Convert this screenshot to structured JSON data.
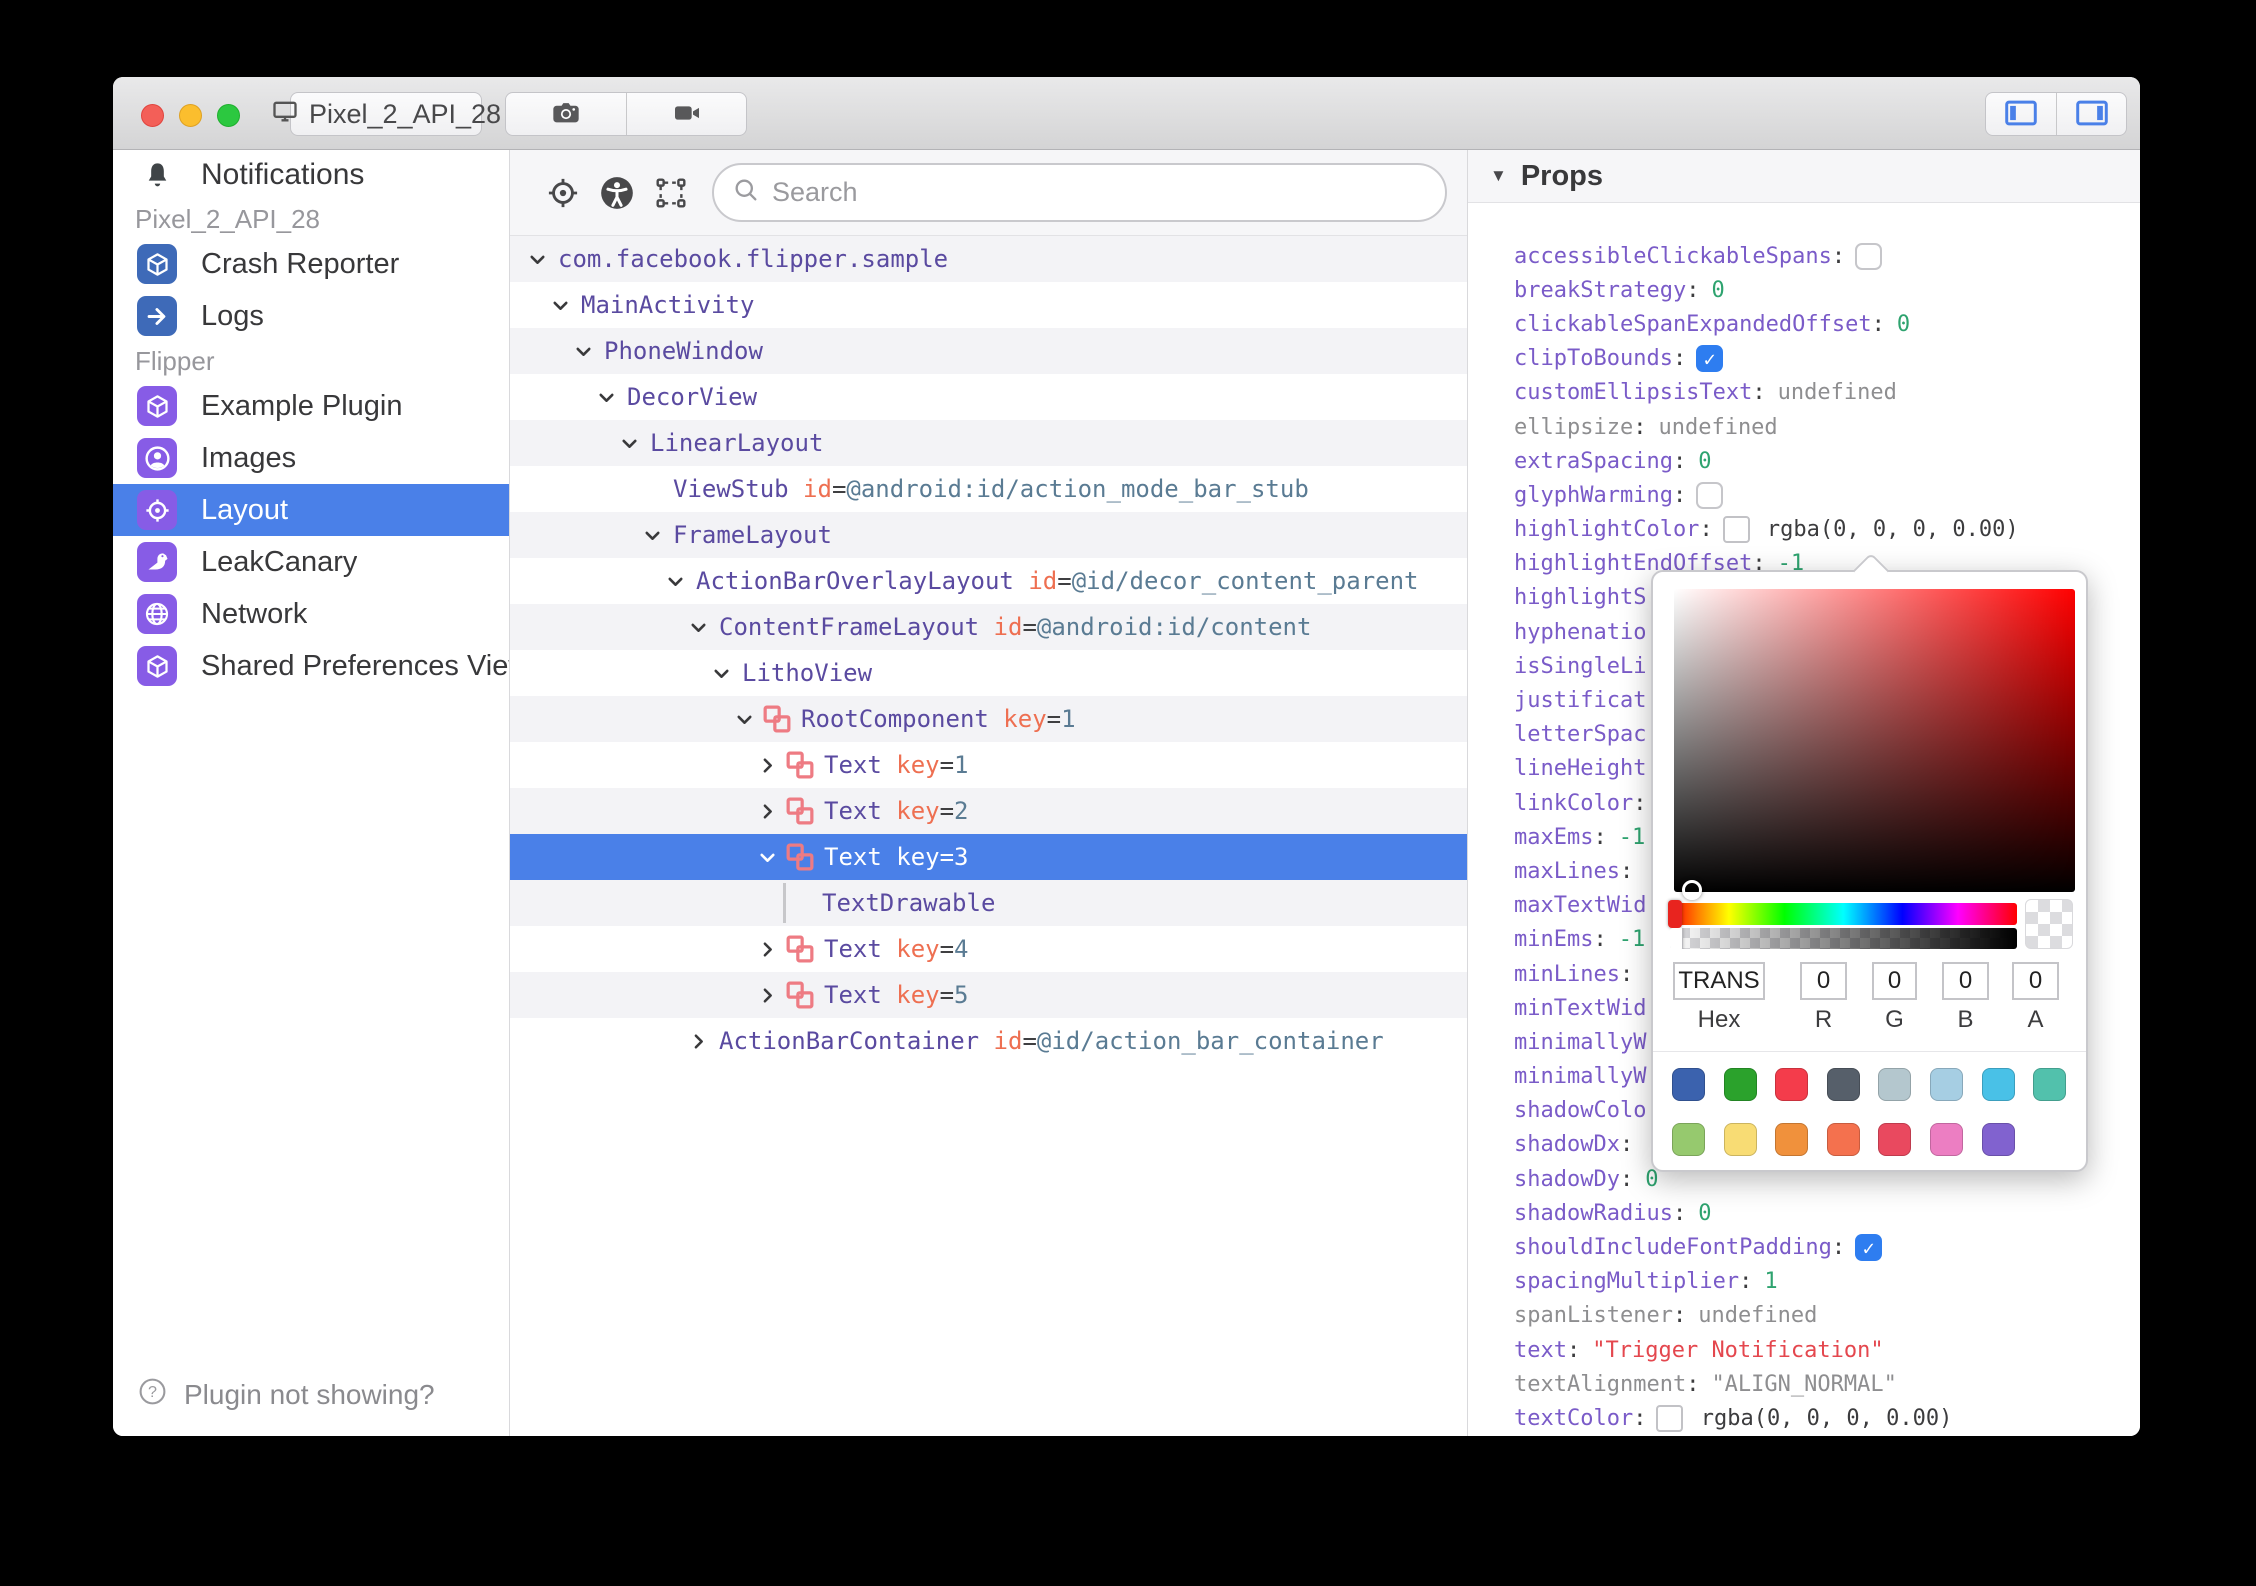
{
  "window": {
    "device_label": "Pixel_2_API_28",
    "traffic_lights": [
      "close",
      "minimize",
      "zoom"
    ],
    "titlebar_buttons": [
      "screenshot-camera",
      "screen-record",
      "toggle-left-panel",
      "toggle-right-panel"
    ]
  },
  "sidebar": {
    "notifications_label": "Notifications",
    "sections": [
      {
        "label": "Pixel_2_API_28",
        "items": [
          {
            "label": "Crash Reporter",
            "icon": "cube",
            "color": "#3e6ab8",
            "selected": false
          },
          {
            "label": "Logs",
            "icon": "arrow",
            "color": "#3e6ab8",
            "selected": false
          }
        ]
      },
      {
        "label": "Flipper",
        "items": [
          {
            "label": "Example Plugin",
            "icon": "cube",
            "color": "#875ce6",
            "selected": false
          },
          {
            "label": "Images",
            "icon": "person",
            "color": "#875ce6",
            "selected": false
          },
          {
            "label": "Layout",
            "icon": "target",
            "color": "#875ce6",
            "selected": true
          },
          {
            "label": "LeakCanary",
            "icon": "bird",
            "color": "#875ce6",
            "selected": false
          },
          {
            "label": "Network",
            "icon": "globe",
            "color": "#875ce6",
            "selected": false
          },
          {
            "label": "Shared Preferences Viewe",
            "icon": "cube",
            "color": "#875ce6",
            "selected": false
          }
        ]
      }
    ],
    "footer": "Plugin not showing?"
  },
  "inspector": {
    "search_placeholder": "Search",
    "toolbar_icons": [
      "target-crosshair",
      "accessibility",
      "expand-selection"
    ],
    "tree": [
      {
        "level": 0,
        "chevron": "down",
        "litho": false,
        "name": "com.facebook.flipper.sample",
        "attr_key": "",
        "attr_value": "",
        "selected": false
      },
      {
        "level": 1,
        "chevron": "down",
        "litho": false,
        "name": "MainActivity",
        "attr_key": "",
        "attr_value": "",
        "selected": false
      },
      {
        "level": 2,
        "chevron": "down",
        "litho": false,
        "name": "PhoneWindow",
        "attr_key": "",
        "attr_value": "",
        "selected": false
      },
      {
        "level": 3,
        "chevron": "down",
        "litho": false,
        "name": "DecorView",
        "attr_key": "",
        "attr_value": "",
        "selected": false
      },
      {
        "level": 4,
        "chevron": "down",
        "litho": false,
        "name": "LinearLayout",
        "attr_key": "",
        "attr_value": "",
        "selected": false
      },
      {
        "level": 5,
        "chevron": "none",
        "litho": false,
        "name": "ViewStub",
        "attr_key": "id",
        "attr_value": "@android:id/action_mode_bar_stub",
        "selected": false
      },
      {
        "level": 5,
        "chevron": "down",
        "litho": false,
        "name": "FrameLayout",
        "attr_key": "",
        "attr_value": "",
        "selected": false
      },
      {
        "level": 6,
        "chevron": "down",
        "litho": false,
        "name": "ActionBarOverlayLayout",
        "attr_key": "id",
        "attr_value": "@id/decor_content_parent",
        "selected": false
      },
      {
        "level": 7,
        "chevron": "down",
        "litho": false,
        "name": "ContentFrameLayout",
        "attr_key": "id",
        "attr_value": "@android:id/content",
        "selected": false
      },
      {
        "level": 8,
        "chevron": "down",
        "litho": false,
        "name": "LithoView",
        "attr_key": "",
        "attr_value": "",
        "selected": false
      },
      {
        "level": 9,
        "chevron": "down",
        "litho": true,
        "name": "RootComponent",
        "attr_key": "key",
        "attr_value": "1",
        "selected": false
      },
      {
        "level": 10,
        "chevron": "right",
        "litho": true,
        "name": "Text",
        "attr_key": "key",
        "attr_value": "1",
        "selected": false
      },
      {
        "level": 10,
        "chevron": "right",
        "litho": true,
        "name": "Text",
        "attr_key": "key",
        "attr_value": "2",
        "selected": false
      },
      {
        "level": 10,
        "chevron": "down",
        "litho": true,
        "name": "Text",
        "attr_key": "key",
        "attr_value": "3",
        "selected": true
      },
      {
        "level": 11,
        "chevron": "line",
        "litho": false,
        "name": "TextDrawable",
        "attr_key": "",
        "attr_value": "",
        "selected": false
      },
      {
        "level": 10,
        "chevron": "right",
        "litho": true,
        "name": "Text",
        "attr_key": "key",
        "attr_value": "4",
        "selected": false
      },
      {
        "level": 10,
        "chevron": "right",
        "litho": true,
        "name": "Text",
        "attr_key": "key",
        "attr_value": "5",
        "selected": false
      },
      {
        "level": 7,
        "chevron": "right",
        "litho": false,
        "name": "ActionBarContainer",
        "attr_key": "id",
        "attr_value": "@id/action_bar_container",
        "selected": false
      }
    ]
  },
  "props_panel": {
    "title": "Props",
    "rows": [
      {
        "key": "accessibleClickableSpans",
        "colon": true,
        "muted": false,
        "type": "checkbox",
        "checked": false,
        "value": ""
      },
      {
        "key": "breakStrategy",
        "colon": true,
        "muted": false,
        "type": "number",
        "checked": false,
        "value": "0"
      },
      {
        "key": "clickableSpanExpandedOffset",
        "colon": true,
        "muted": false,
        "type": "number",
        "checked": false,
        "value": "0"
      },
      {
        "key": "clipToBounds",
        "colon": true,
        "muted": false,
        "type": "checkbox",
        "checked": true,
        "value": ""
      },
      {
        "key": "customEllipsisText",
        "colon": true,
        "muted": false,
        "type": "undef",
        "checked": false,
        "value": "undefined"
      },
      {
        "key": "ellipsize",
        "colon": true,
        "muted": true,
        "type": "undef",
        "checked": false,
        "value": "undefined"
      },
      {
        "key": "extraSpacing",
        "colon": true,
        "muted": false,
        "type": "number",
        "checked": false,
        "value": "0"
      },
      {
        "key": "glyphWarming",
        "colon": true,
        "muted": false,
        "type": "checkbox",
        "checked": false,
        "value": ""
      },
      {
        "key": "highlightColor",
        "colon": true,
        "muted": false,
        "type": "color",
        "checked": false,
        "value": "rgba(0, 0, 0, 0.00)"
      },
      {
        "key": "highlightEndOffset",
        "colon": true,
        "muted": false,
        "type": "number",
        "checked": false,
        "value": "-1"
      },
      {
        "key": "highlightS",
        "colon": false,
        "muted": false,
        "type": "none",
        "checked": false,
        "value": ""
      },
      {
        "key": "hyphenatio",
        "colon": false,
        "muted": false,
        "type": "none",
        "checked": false,
        "value": ""
      },
      {
        "key": "isSingleLi",
        "colon": false,
        "muted": false,
        "type": "none",
        "checked": false,
        "value": ""
      },
      {
        "key": "justificat",
        "colon": false,
        "muted": false,
        "type": "none",
        "checked": false,
        "value": ""
      },
      {
        "key": "letterSpac",
        "colon": false,
        "muted": false,
        "type": "none",
        "checked": false,
        "value": ""
      },
      {
        "key": "lineHeight",
        "colon": false,
        "muted": false,
        "type": "none",
        "checked": false,
        "value": ""
      },
      {
        "key": "linkColor",
        "colon": true,
        "muted": false,
        "type": "none",
        "checked": false,
        "value": ""
      },
      {
        "key": "maxEms",
        "colon": true,
        "muted": false,
        "type": "number",
        "checked": false,
        "value": "-1"
      },
      {
        "key": "maxLines",
        "colon": true,
        "muted": false,
        "type": "none",
        "checked": false,
        "value": ""
      },
      {
        "key": "maxTextWid",
        "colon": false,
        "muted": false,
        "type": "none",
        "checked": false,
        "value": ""
      },
      {
        "key": "minEms",
        "colon": true,
        "muted": false,
        "type": "number",
        "checked": false,
        "value": "-1"
      },
      {
        "key": "minLines",
        "colon": true,
        "muted": false,
        "type": "none",
        "checked": false,
        "value": ""
      },
      {
        "key": "minTextWid",
        "colon": false,
        "muted": false,
        "type": "none",
        "checked": false,
        "value": ""
      },
      {
        "key": "minimallyW",
        "colon": false,
        "muted": false,
        "type": "none",
        "checked": false,
        "value": ""
      },
      {
        "key": "minimallyW",
        "colon": false,
        "muted": false,
        "type": "none",
        "checked": false,
        "value": ""
      },
      {
        "key": "shadowColo",
        "colon": false,
        "muted": false,
        "type": "none",
        "checked": false,
        "value": ""
      },
      {
        "key": "shadowDx",
        "colon": true,
        "muted": false,
        "type": "none",
        "checked": false,
        "value": ""
      },
      {
        "key": "shadowDy",
        "colon": true,
        "muted": false,
        "type": "number",
        "checked": false,
        "value": "0"
      },
      {
        "key": "shadowRadius",
        "colon": true,
        "muted": false,
        "type": "number",
        "checked": false,
        "value": "0"
      },
      {
        "key": "shouldIncludeFontPadding",
        "colon": true,
        "muted": false,
        "type": "checkbox",
        "checked": true,
        "value": ""
      },
      {
        "key": "spacingMultiplier",
        "colon": true,
        "muted": false,
        "type": "number",
        "checked": false,
        "value": "1"
      },
      {
        "key": "spanListener",
        "colon": true,
        "muted": true,
        "type": "undef",
        "checked": false,
        "value": "undefined"
      },
      {
        "key": "text",
        "colon": true,
        "muted": false,
        "type": "string",
        "checked": false,
        "value": "\"Trigger Notification\""
      },
      {
        "key": "textAlignment",
        "colon": true,
        "muted": true,
        "type": "undef",
        "checked": false,
        "value": "\"ALIGN_NORMAL\""
      },
      {
        "key": "textColor",
        "colon": true,
        "muted": false,
        "type": "color",
        "checked": false,
        "value": "rgba(0, 0, 0, 0.00)"
      }
    ]
  },
  "color_picker": {
    "hex_value": "TRANS",
    "r_value": "0",
    "g_value": "0",
    "b_value": "0",
    "a_value": "0",
    "labels": {
      "hex": "Hex",
      "r": "R",
      "g": "G",
      "b": "B",
      "a": "A"
    },
    "preset_rows": [
      [
        "#3b62ae",
        "#2ba22c",
        "#f43c4b",
        "#565f6a",
        "#b4c7ce",
        "#a6cee3",
        "#49c1e7",
        "#52c1ac"
      ],
      [
        "#96c96e",
        "#f8dc74",
        "#f0913c",
        "#f4714e",
        "#e9495f",
        "#ec7ec2",
        "#8162cf"
      ]
    ]
  },
  "colors": {
    "accent_blue": "#4a80e8",
    "plugin_purple": "#875ce6",
    "plugin_blue": "#3e6ab8",
    "litho_pink": "#ee7b83",
    "tree_name_purple": "#5a4aa0",
    "attr_key_orange": "#ee6f51",
    "attr_value_slate": "#5a7b93",
    "prop_key_purple": "#7a5bc8",
    "prop_number_green": "#2ea36f",
    "prop_string_red": "#e4474e",
    "muted_gray": "#8e8e90",
    "checkbox_blue": "#2e7df0"
  }
}
